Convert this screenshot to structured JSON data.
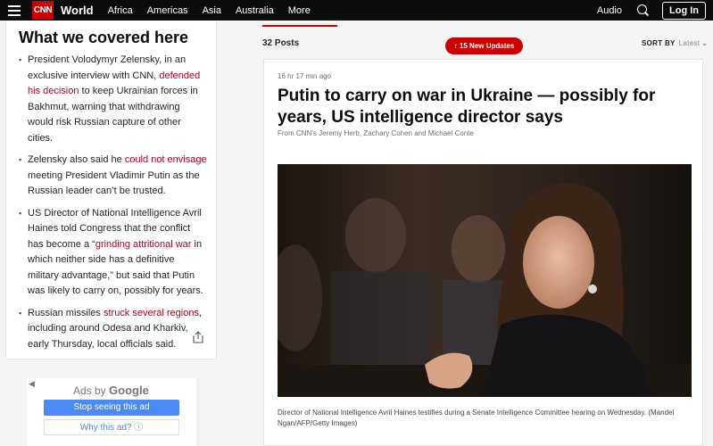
{
  "nav": {
    "logo": "CNN",
    "section": "World",
    "links": [
      "Africa",
      "Americas",
      "Asia",
      "Australia",
      "More"
    ],
    "audio": "Audio",
    "login": "Log In"
  },
  "covered": {
    "title": "What we covered here",
    "bullets": [
      {
        "before": "President Volodymyr Zelensky, in an exclusive interview with CNN, ",
        "link": "defended his decision",
        "after": " to keep Ukrainian forces in Bakhmut, warning that withdrawing would risk Russian capture of other cities."
      },
      {
        "before": "Zelensky also said he ",
        "link": "could not envisage",
        "after": " meeting President Vladimir Putin as the Russian leader can’t be trusted."
      },
      {
        "before": "US Director of National Intelligence Avril Haines told Congress that the conflict has become a “",
        "link": "grinding attritional war",
        "after": " in which neither side has a definitive military advantage,” but said that Putin was likely to carry on, possibly for years."
      },
      {
        "before": "Russian missiles ",
        "link": "struck several regions",
        "after": ", including around Odesa and Kharkiv, early Thursday, local officials said."
      }
    ]
  },
  "ad": {
    "ads_by": "Ads by",
    "google": "Google",
    "stop": "Stop seeing this ad",
    "why": "Why this ad?",
    "info": "ⓘ"
  },
  "feed": {
    "posts_count": "32 Posts",
    "new_updates": "15 New Updates",
    "sort_by": "SORT BY",
    "sort_value": "Latest"
  },
  "post": {
    "time": "16 hr 17 min ago",
    "headline": "Putin to carry on war in Ukraine — possibly for years, US intelligence director says",
    "byline": "From CNN’s Jeremy Herb, Zachary Cohen and Michael Conte",
    "caption": "Director of National Intelligence Avril Haines testifies during a Senate Intelligence Committee hearing on Wednesday. (Mandel Ngan/AFP/Getty Images)"
  },
  "colors": {
    "brand_red": "#cc0000",
    "link_red": "#b8001f",
    "nav_bg": "#0c0c0c",
    "google_blue": "#4a8af4"
  }
}
